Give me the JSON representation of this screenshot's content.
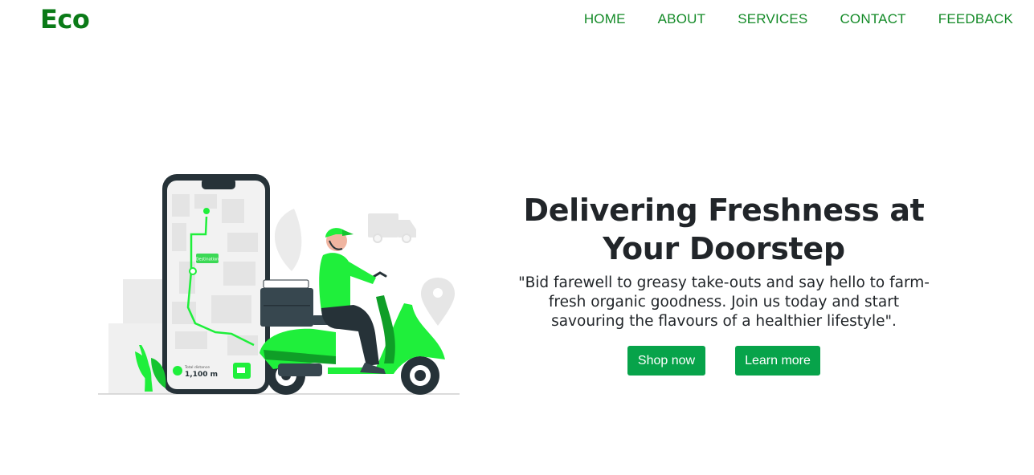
{
  "nav": {
    "brand": "Eco",
    "links": [
      "HOME",
      "ABOUT",
      "SERVICES",
      "CONTACT",
      "FEEDBACK"
    ]
  },
  "hero": {
    "title": "Delivering Freshness at Your Doorstep",
    "quote": "\"Bid farewell to greasy take-outs and say hello to farm-fresh organic goodness. Join us today and start savouring the flavours of a healthier lifestyle\".",
    "buttons": {
      "shop": "Shop now",
      "learn": "Learn more"
    }
  },
  "illustration": {
    "phone_label": "Total distance",
    "phone_distance": "1,100 m",
    "map_tag": "Destination"
  },
  "colors": {
    "brand": "#0a7a17",
    "nav_link": "#138a27",
    "button": "#07a34a",
    "scooter_green": "#1fef3b",
    "dark": "#263238"
  }
}
